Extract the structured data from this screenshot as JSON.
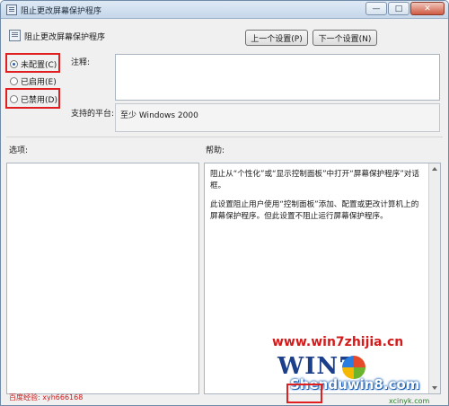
{
  "window": {
    "title": "阻止更改屏幕保护程序",
    "minimize_glyph": "—",
    "maximize_glyph": "□",
    "close_glyph": "✕"
  },
  "header": {
    "title": "阻止更改屏幕保护程序",
    "prev_button": "上一个设置(P)",
    "next_button": "下一个设置(N)"
  },
  "options": {
    "selected": "not_configured",
    "not_configured": "未配置(C)",
    "enabled": "已启用(E)",
    "disabled": "已禁用(D)"
  },
  "comment": {
    "label": "注释:",
    "value": ""
  },
  "platform": {
    "label": "支持的平台:",
    "value": "至少 Windows 2000"
  },
  "sections": {
    "options_label": "选项:",
    "help_label": "帮助:"
  },
  "help": {
    "paragraph1": "阻止从“个性化”或“显示控制面板”中打开“屏幕保护程序”对话框。",
    "paragraph2": "此设置阻止用户使用“控制面板”添加、配置或更改计算机上的屏幕保护程序。但此设置不阻止运行屏幕保护程序。"
  },
  "watermarks": {
    "domain": "www.win7zhijia.cn",
    "logo": "WIN7",
    "site": "Shenduwin8.com",
    "small": "xcinyk.com",
    "left": "百度经验: xyh666168"
  },
  "colors": {
    "highlight": "#e02020",
    "titlebar": "#c5d7ea"
  }
}
